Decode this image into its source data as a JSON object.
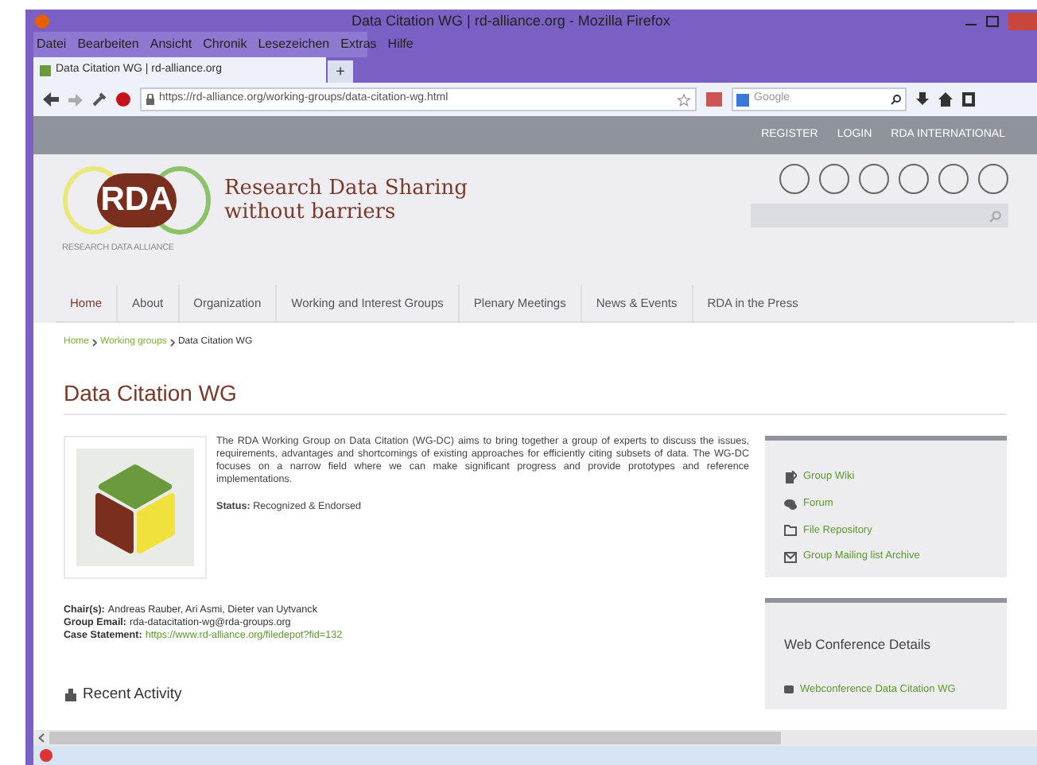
{
  "window": {
    "title": "Data Citation WG | rd-alliance.org - Mozilla Firefox"
  },
  "menu": [
    "Datei",
    "Bearbeiten",
    "Ansicht",
    "Chronik",
    "Lesezeichen",
    "Extras",
    "Hilfe"
  ],
  "tabs": [
    {
      "label": "Data Citation WG | rd-alliance.org",
      "selected": true
    }
  ],
  "new_tab": "+",
  "address": {
    "value": "https://rd-alliance.org/working-groups/data-citation-wg.html"
  },
  "search": {
    "placeholder": "Google"
  },
  "top_links": [
    "REGISTER",
    "LOGIN",
    "RDA INTERNATIONAL"
  ],
  "logo": {
    "text": "RDA",
    "subtitle": "RESEARCH DATA ALLIANCE"
  },
  "tagline": [
    "Research Data Sharing",
    "without barriers"
  ],
  "nav": [
    "Home",
    "About",
    "Organization",
    "Working and Interest Groups",
    "Plenary Meetings",
    "News & Events",
    "RDA in the Press"
  ],
  "breadcrumb": [
    {
      "label": "Home",
      "link": true
    },
    {
      "label": "Working groups",
      "link": true
    },
    {
      "label": "Data Citation WG",
      "link": false
    }
  ],
  "page_title": "Data Citation WG",
  "description": "The RDA Working Group on Data Citation (WG-DC) aims to bring together a group of experts to discuss the issues, requirements, advantages and shortcomings of existing approaches for efficiently citing subsets of data. The WG-DC focuses on a narrow field where we can make significant progress and provide prototypes and reference implementations.",
  "status": "**Status:** Recognized & Endorsed",
  "details": [
    {
      "label": "Chair(s):",
      "value": "Andreas Rauber, Ari Asmi, Dieter van Uytvanck",
      "link": false
    },
    {
      "label": "Group Email:",
      "value": "rda-datacitation-wg@rda-groups.org",
      "link": false
    },
    {
      "label": "Case Statement:",
      "value": "https://www.rd-alliance.org/filedepot?fid=132",
      "link": true
    }
  ],
  "recent_activity": "Recent Activity",
  "sidebar_links": [
    {
      "label": "Group Wiki",
      "kind": "wiki"
    },
    {
      "label": "Forum",
      "kind": "forum"
    },
    {
      "label": "File Repository",
      "kind": "files"
    },
    {
      "label": "Group Mailing list Archive",
      "kind": "mail"
    }
  ],
  "web_conference": {
    "title": "Web Conference Details",
    "links": [
      "Webconference Data Citation WG"
    ]
  }
}
